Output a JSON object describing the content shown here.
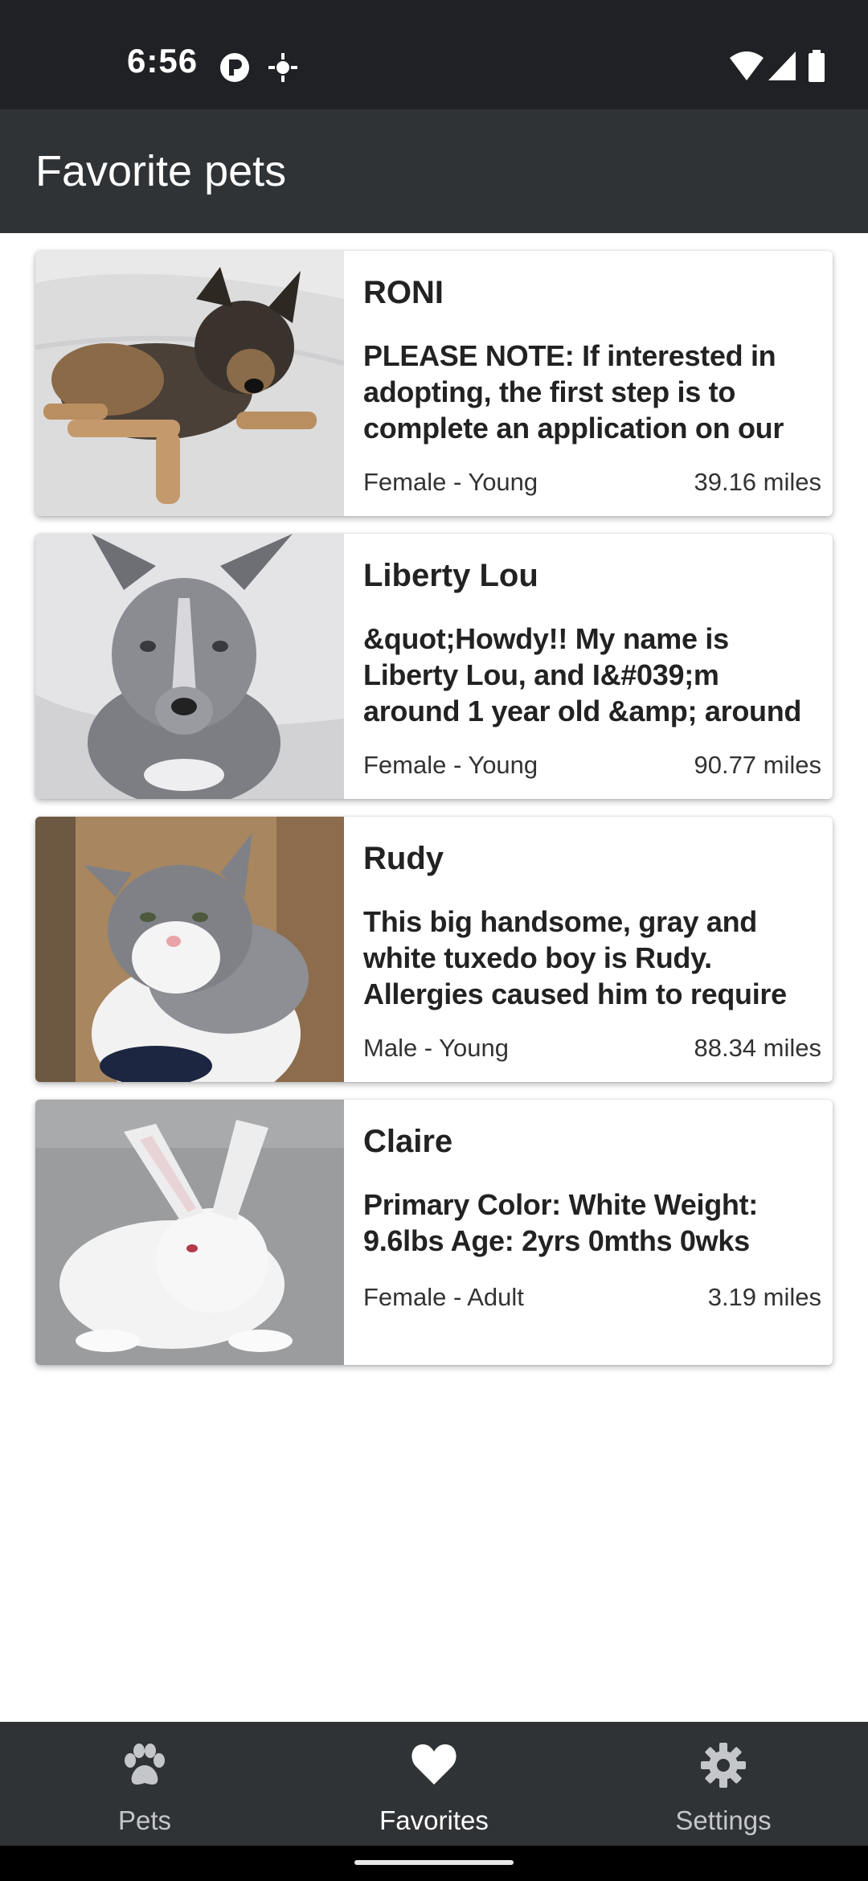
{
  "status_bar": {
    "time": "6:56"
  },
  "app_bar": {
    "title": "Favorite pets"
  },
  "pets": [
    {
      "name": "RONI",
      "description": "PLEASE NOTE:   If interested in adopting, the first step is to complete an application on our",
      "meta": "Female - Young",
      "distance": "39.16 miles",
      "photo": "dog-photo"
    },
    {
      "name": "Liberty Lou",
      "description": "&quot;Howdy!! My name is Liberty Lou, and I&#039;m around 1 year old &amp; around",
      "meta": "Female - Young",
      "distance": "90.77 miles",
      "photo": "dog-photo"
    },
    {
      "name": "Rudy",
      "description": "This big handsome, gray and white tuxedo boy is Rudy. Allergies caused him to require",
      "meta": "Male - Young",
      "distance": "88.34 miles",
      "photo": "cat-photo"
    },
    {
      "name": "Claire",
      "description": "Primary Color: White Weight: 9.6lbs Age: 2yrs 0mths 0wks",
      "meta": "Female - Adult",
      "distance": "3.19 miles",
      "photo": "rabbit-photo"
    }
  ],
  "bottom_nav": {
    "items": [
      {
        "label": "Pets",
        "icon": "paw-icon",
        "active": false
      },
      {
        "label": "Favorites",
        "icon": "heart-icon",
        "active": true
      },
      {
        "label": "Settings",
        "icon": "gear-icon",
        "active": false
      }
    ]
  },
  "colors": {
    "status_bar": "#202124",
    "app_bar": "#303336",
    "nav_active": "#ffffff",
    "nav_inactive": "#c4c6c9"
  }
}
